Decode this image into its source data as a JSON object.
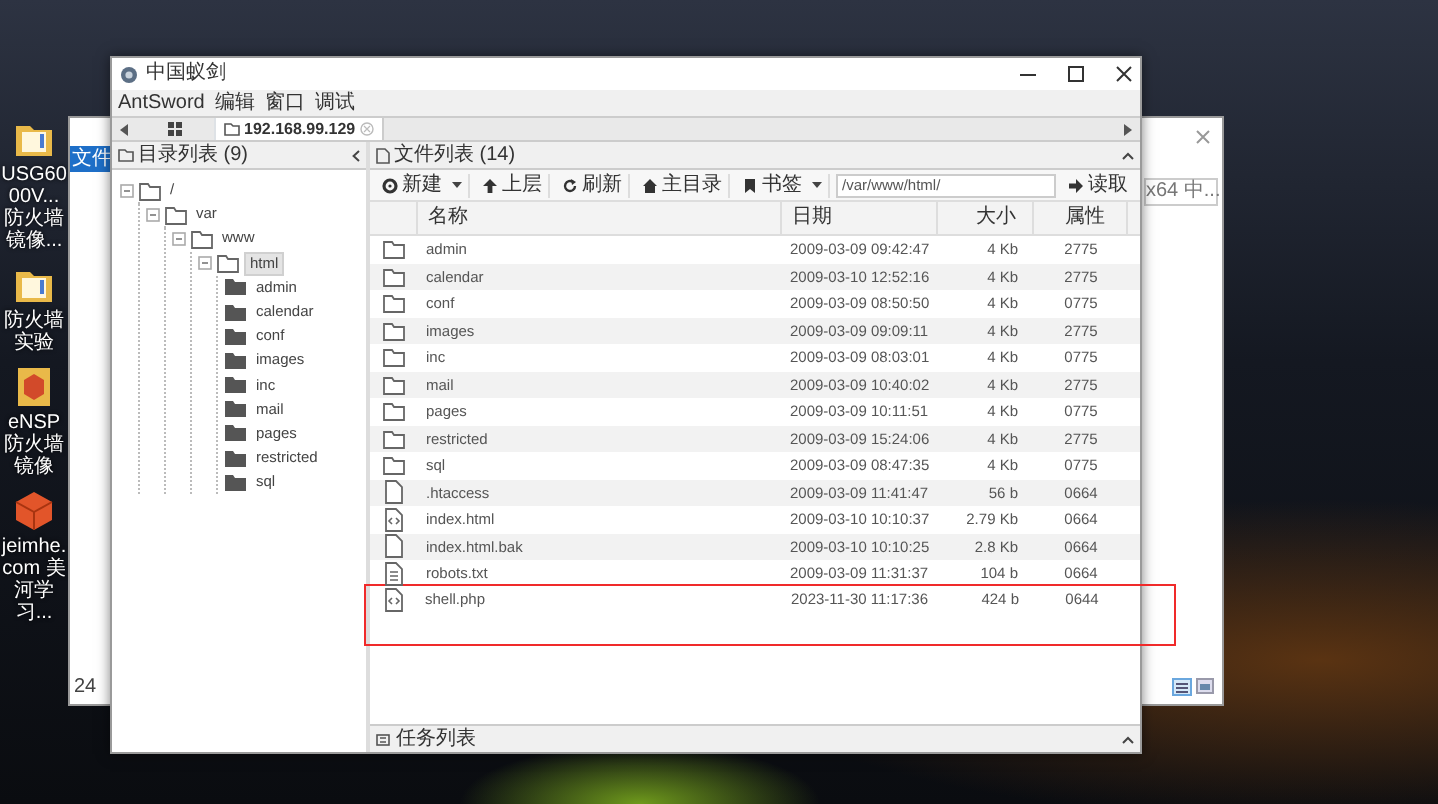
{
  "desktop": {
    "icons": [
      {
        "kind": "folder",
        "label": "USG6000V... 防火墙镜像..."
      },
      {
        "kind": "folder",
        "label": "防火墙实验"
      },
      {
        "kind": "package",
        "label": "eNSP 防火墙镜像"
      },
      {
        "kind": "box",
        "label": "jeimhe.com 美河学习..."
      }
    ]
  },
  "background_window": {
    "menu_label": "文件",
    "status": "24",
    "search_text": "x64 中..."
  },
  "window": {
    "title": "中国蚁剑",
    "menu": [
      "AntSword",
      "编辑",
      "窗口",
      "调试"
    ],
    "tabs": [
      {
        "label": "192.168.99.129",
        "selected": true
      }
    ],
    "directory_panel": {
      "title": "目录列表 (9)",
      "tree": [
        {
          "label": "/",
          "expanded": true,
          "selected": false,
          "children": [
            {
              "label": "var",
              "expanded": true,
              "selected": false,
              "children": [
                {
                  "label": "www",
                  "expanded": true,
                  "selected": false,
                  "children": [
                    {
                      "label": "html",
                      "expanded": true,
                      "selected": true,
                      "children": [
                        {
                          "label": "admin",
                          "expanded": false,
                          "selected": false
                        },
                        {
                          "label": "calendar",
                          "expanded": false,
                          "selected": false
                        },
                        {
                          "label": "conf",
                          "expanded": false,
                          "selected": false
                        },
                        {
                          "label": "images",
                          "expanded": false,
                          "selected": false
                        },
                        {
                          "label": "inc",
                          "expanded": false,
                          "selected": false
                        },
                        {
                          "label": "mail",
                          "expanded": false,
                          "selected": false
                        },
                        {
                          "label": "pages",
                          "expanded": false,
                          "selected": false
                        },
                        {
                          "label": "restricted",
                          "expanded": false,
                          "selected": false
                        },
                        {
                          "label": "sql",
                          "expanded": false,
                          "selected": false
                        }
                      ]
                    }
                  ]
                }
              ]
            }
          ]
        }
      ]
    },
    "file_panel": {
      "title": "文件列表 (14)",
      "toolbar": [
        {
          "kind": "new",
          "label": "新建",
          "dropdown": true
        },
        {
          "kind": "up",
          "label": "上层",
          "dropdown": false
        },
        {
          "kind": "refresh",
          "label": "刷新",
          "dropdown": false
        },
        {
          "kind": "home",
          "label": "主目录",
          "dropdown": false
        },
        {
          "kind": "bookmark",
          "label": "书签",
          "dropdown": true
        }
      ],
      "path": "/var/www/html/",
      "read_button": "读取",
      "columns": [
        "名称",
        "日期",
        "大小",
        "属性"
      ],
      "rows": [
        {
          "kind": "folder",
          "name": "admin",
          "date": "2009-03-09 09:42:47",
          "size": "4 Kb",
          "perm": "2775",
          "highlighted": false
        },
        {
          "kind": "folder",
          "name": "calendar",
          "date": "2009-03-10 12:52:16",
          "size": "4 Kb",
          "perm": "2775",
          "highlighted": false
        },
        {
          "kind": "folder",
          "name": "conf",
          "date": "2009-03-09 08:50:50",
          "size": "4 Kb",
          "perm": "0775",
          "highlighted": false
        },
        {
          "kind": "folder",
          "name": "images",
          "date": "2009-03-09 09:09:11",
          "size": "4 Kb",
          "perm": "2775",
          "highlighted": false
        },
        {
          "kind": "folder",
          "name": "inc",
          "date": "2009-03-09 08:03:01",
          "size": "4 Kb",
          "perm": "0775",
          "highlighted": false
        },
        {
          "kind": "folder",
          "name": "mail",
          "date": "2009-03-09 10:40:02",
          "size": "4 Kb",
          "perm": "2775",
          "highlighted": false
        },
        {
          "kind": "folder",
          "name": "pages",
          "date": "2009-03-09 10:11:51",
          "size": "4 Kb",
          "perm": "0775",
          "highlighted": false
        },
        {
          "kind": "folder",
          "name": "restricted",
          "date": "2009-03-09 15:24:06",
          "size": "4 Kb",
          "perm": "2775",
          "highlighted": false
        },
        {
          "kind": "folder",
          "name": "sql",
          "date": "2009-03-09 08:47:35",
          "size": "4 Kb",
          "perm": "0775",
          "highlighted": false
        },
        {
          "kind": "file",
          "name": ".htaccess",
          "date": "2009-03-09 11:41:47",
          "size": "56 b",
          "perm": "0664",
          "highlighted": false
        },
        {
          "kind": "code",
          "name": "index.html",
          "date": "2009-03-10 10:10:37",
          "size": "2.79 Kb",
          "perm": "0664",
          "highlighted": false
        },
        {
          "kind": "file",
          "name": "index.html.bak",
          "date": "2009-03-10 10:10:25",
          "size": "2.8 Kb",
          "perm": "0664",
          "highlighted": false
        },
        {
          "kind": "text",
          "name": "robots.txt",
          "date": "2009-03-09 11:31:37",
          "size": "104 b",
          "perm": "0664",
          "highlighted": false
        },
        {
          "kind": "code",
          "name": "shell.php",
          "date": "2023-11-30 11:17:36",
          "size": "424 b",
          "perm": "0644",
          "highlighted": true
        }
      ]
    },
    "task_panel": {
      "title": "任务列表"
    }
  }
}
